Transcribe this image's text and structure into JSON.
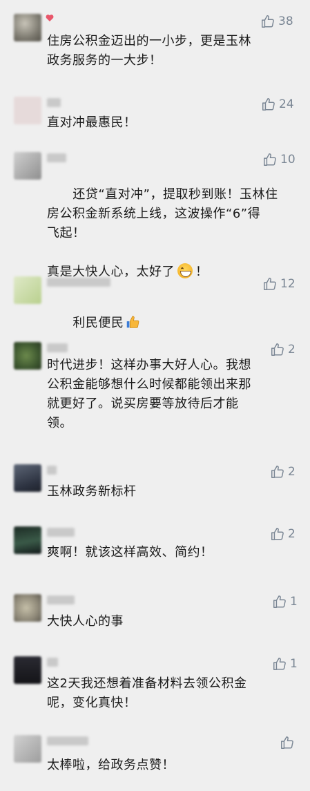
{
  "comments": [
    {
      "likes": "38",
      "text": "住房公积金迈出的一小步，更是玉林\n政务服务的一大步！",
      "avatar_color": "#8a8a80"
    },
    {
      "likes": "24",
      "text": "直对冲最惠民！",
      "avatar_color": "#e7d9d9"
    },
    {
      "likes": "10",
      "text_lines_a": "还贷“直对冲”，提取秒到账！玉林住\n房公积金新系统上线，这波操作“6”得\n飞起！",
      "text_line_b_pre": "真是大快人心，太好了",
      "text_line_b_post": "！",
      "avatar_color": "#a9a9a9"
    },
    {
      "likes": "12",
      "text": "利民便民",
      "avatar_color": "#cfe0b0"
    },
    {
      "likes": "2",
      "text": "时代进步！这样办事大好人心。我想\n公积金能够想什么时候都能领出来那\n就更好了。说买房要等放待后才能\n领。",
      "avatar_color": "#4f6a3a"
    },
    {
      "likes": "2",
      "text": "玉林政务新标杆",
      "avatar_color": "#3a4150"
    },
    {
      "likes": "2",
      "text": "爽啊！就该这样高效、简约！",
      "avatar_color": "#2c3f38"
    },
    {
      "likes": "1",
      "text": "大快人心的事",
      "avatar_color": "#9e9a8c"
    },
    {
      "likes": "1",
      "text": "这2天我还想着准备材料去领公积金\n呢，变化真快！",
      "avatar_color": "#1e1e22"
    },
    {
      "likes": "",
      "text": "太棒啦，给政务点赞！",
      "avatar_color": "#b7b7b7"
    }
  ],
  "colors": {
    "background": "#efefef",
    "text": "#1a1a1a",
    "like": "#7a8694",
    "heart": "#e8566a"
  },
  "icons": {
    "like": "thumbs-up-outline-icon",
    "heart": "heart-icon",
    "grin_emoji": "grinning-face-emoji",
    "thumb_emoji": "thumbs-up-emoji"
  }
}
